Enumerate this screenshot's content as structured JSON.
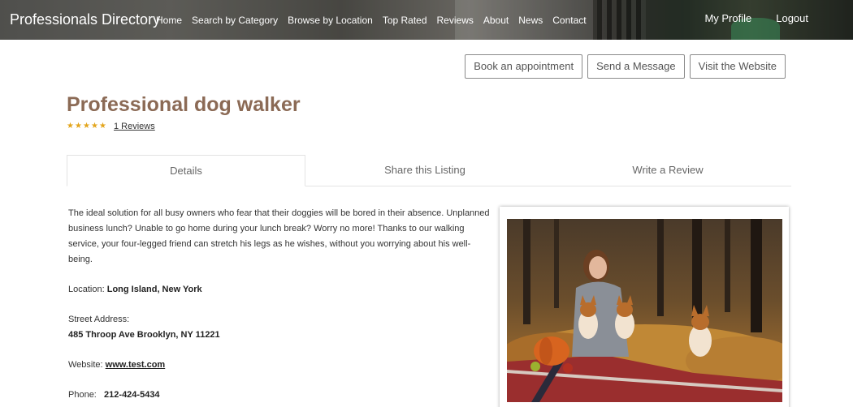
{
  "header": {
    "brand": "Professionals Directory",
    "nav": [
      "Home",
      "Search by Category",
      "Browse by Location",
      "Top Rated",
      "Reviews",
      "About",
      "News",
      "Contact"
    ],
    "my_profile": "My Profile",
    "logout": "Logout"
  },
  "actions": {
    "book": "Book an appointment",
    "message": "Send a Message",
    "website": "Visit the Website"
  },
  "listing": {
    "title": "Professional dog walker",
    "rating": 5,
    "reviews_link": "1 Reviews"
  },
  "tabs": [
    "Details",
    "Share this Listing",
    "Write a Review"
  ],
  "details": {
    "description": "The ideal solution for all busy owners who fear that their doggies will be bored in their absence. Unplanned business lunch? Unable to go home during your lunch break? Worry no more! Thanks to our walking service, your four-legged friend can stretch his legs as he wishes, without you worrying about his well-being.",
    "location_label": "Location:",
    "location_value": "Long Island, New York",
    "street_label": "Street Address:",
    "street_value": "485 Throop Ave Brooklyn, NY 11221",
    "website_label": "Website:",
    "website_value": "www.test.com",
    "phone_label": "Phone:",
    "phone_value": "212-424-5434"
  },
  "colors": {
    "title": "#8b6a55",
    "star": "#e3a51c"
  }
}
